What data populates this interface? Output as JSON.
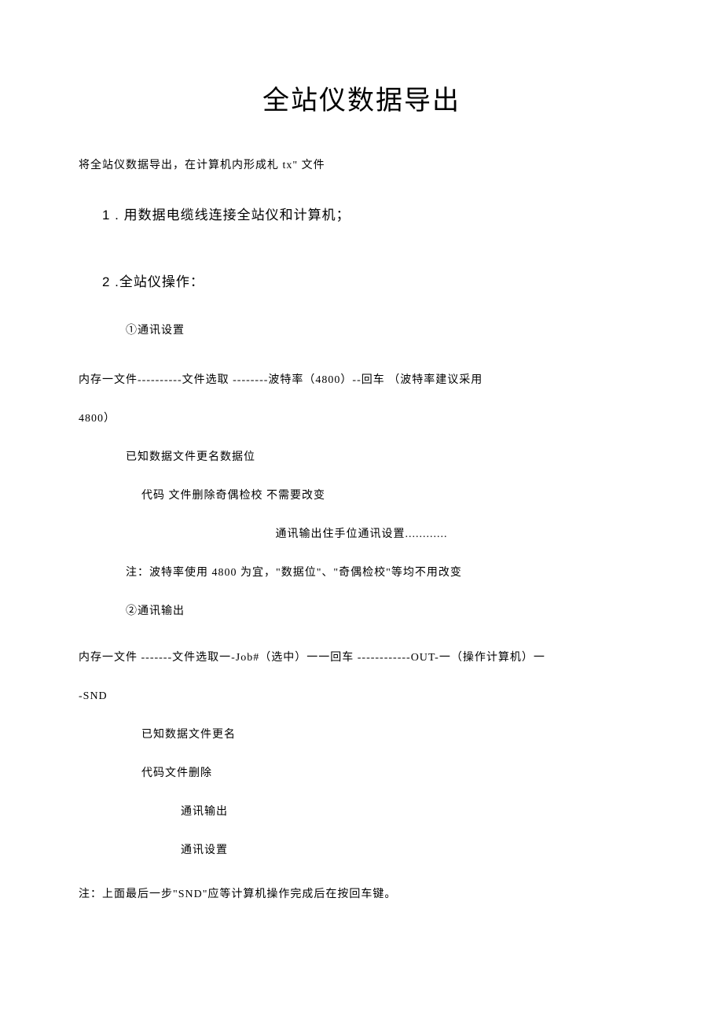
{
  "title": "全站仪数据导出",
  "intro": "将全站仪数据导出，在计算机内形成札 tx\" 文件",
  "section1": {
    "heading": "1 . 用数据电缆线连接全站仪和计算机；"
  },
  "section2": {
    "heading": "2  .全站仪操作：",
    "item1": {
      "label": "①通讯设置",
      "line1": "内存一文件----------文件选取 --------波特率（4800）--回车                （波特率建议采用",
      "line2": "4800）",
      "line3": "已知数据文件更名数据位",
      "line4": "代码      文件删除奇偶检校        不需要改变",
      "line5": "通讯输出住手位通讯设置............",
      "note": "注：波特率使用 4800 为宜，\"数据位\"、\"奇偶检校\"等均不用改变"
    },
    "item2": {
      "label": "②通讯输出",
      "line1": "内存一文件 -------文件选取一-Job#（选中）一一回车 ------------OUT-一（操作计算机）一",
      "line2": "-SND",
      "line3": "已知数据文件更名",
      "line4": "代码文件删除",
      "line5": "通讯输出",
      "line6": "通讯设置"
    }
  },
  "footnote": "注：上面最后一步\"SND\"应等计算机操作完成后在按回车键。"
}
